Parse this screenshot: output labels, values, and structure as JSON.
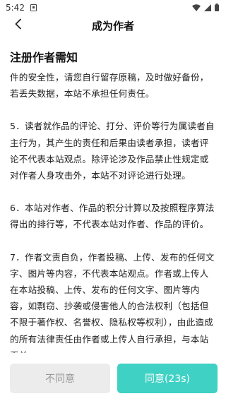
{
  "status_bar": {
    "time": "5:42"
  },
  "header": {
    "title": "成为作者"
  },
  "notice": {
    "title": "注册作者需知",
    "paragraphs": [
      "件的安全性，请您自行留存原稿，及时做好备份，若丢失数据，本站不承担任何责任。",
      "5．读者就作品的评论、打分、评价等行为属读者自主行为，其产生的责任和后果由读者承担，读者评论不代表本站观点。除评论涉及作品禁止性规定或对作者人身攻击外，本站不对评论进行处理。",
      "6．本站对作者、作品的积分计算以及按照程序算法得出的排行等，不代表本站对作者、作品的评价。",
      "7．作者文责自负，作者投稿、上传、发布的任何文字、图片等内容，不代表本站观点。作者或上传人在本站投稿、上传、发布的任何文字、图片等内容，如剽窃、抄袭或侵害他人的合法权利（包括但不限于著作权、名誉权、隐私权等权利），由此造成的所有法律责任由作者或上传人自行承担，与本站无关。"
    ]
  },
  "actions": {
    "disagree_label": "不同意",
    "agree_label": "同意(23s)"
  },
  "colors": {
    "agree_bg": "#3fd1c4",
    "disagree_bg": "#ececec"
  }
}
